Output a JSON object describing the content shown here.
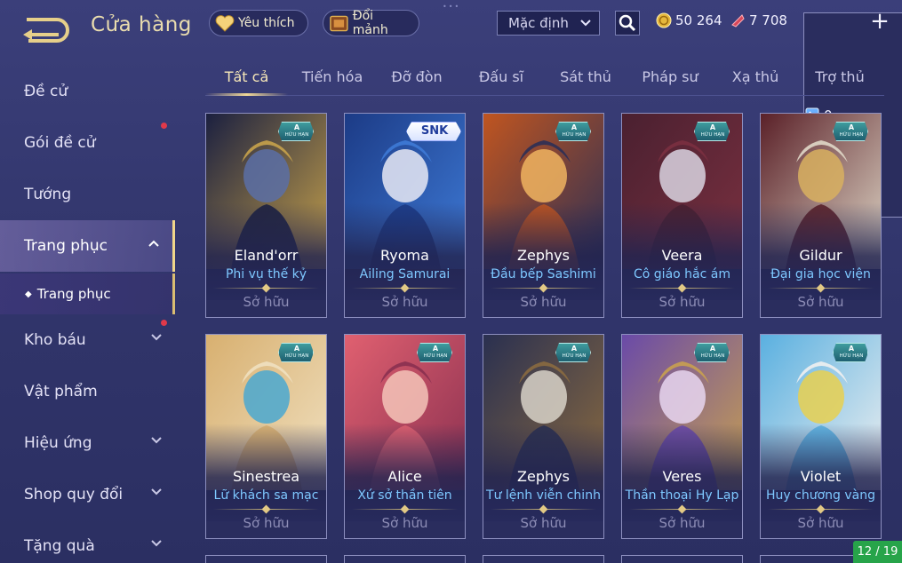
{
  "header": {
    "title": "Cửa hàng",
    "favorites_label": "Yêu thích",
    "exchange_label": "Đổi mảnh",
    "sort_value": "Mặc định",
    "currency_gold": "50 264",
    "currency_voucher": "7 708",
    "currency_card": "0",
    "add_symbol": "+",
    "drag_dots": "•••"
  },
  "sidebar": {
    "items": [
      {
        "label": "Đề cử"
      },
      {
        "label": "Gói đề cử"
      },
      {
        "label": "Tướng"
      },
      {
        "label": "Trang phục"
      },
      {
        "label": "Kho báu"
      },
      {
        "label": "Vật phẩm"
      },
      {
        "label": "Hiệu ứng"
      },
      {
        "label": "Shop quy đổi"
      },
      {
        "label": "Tặng quà"
      }
    ],
    "sub_item": "Trang phục"
  },
  "tabs": [
    "Tất cả",
    "Tiến hóa",
    "Đỡ đòn",
    "Đấu sĩ",
    "Sát thủ",
    "Pháp sư",
    "Xạ thủ",
    "Trợ thủ"
  ],
  "badge": {
    "grade": "A",
    "text": "HỮU HẠN",
    "snk": "SNK"
  },
  "cards": [
    {
      "hero": "Eland'orr",
      "skin": "Phi vụ thế kỷ",
      "status": "Sở hữu",
      "palette": [
        "#1b2040",
        "#5b6fa6",
        "#c7a24b"
      ]
    },
    {
      "hero": "Ryoma",
      "skin": "Ailing Samurai",
      "status": "Sở hữu",
      "palette": [
        "#1c3b86",
        "#e7e9f5",
        "#3e7ad6"
      ]
    },
    {
      "hero": "Zephys",
      "skin": "Đầu bếp Sashimi",
      "status": "Sở hữu",
      "palette": [
        "#c05520",
        "#f0b460",
        "#2c2f55"
      ]
    },
    {
      "hero": "Veera",
      "skin": "Cô giáo hắc ám",
      "status": "Sở hữu",
      "palette": [
        "#4a2030",
        "#d9d3e0",
        "#7a3040"
      ]
    },
    {
      "hero": "Gildur",
      "skin": "Đại gia học viện",
      "status": "Sở hữu",
      "palette": [
        "#5a2028",
        "#d8b060",
        "#e0d8c8"
      ]
    },
    {
      "hero": "Sinestrea",
      "skin": "Lữ khách sa mạc",
      "status": "Sở hữu",
      "palette": [
        "#d8b070",
        "#4aa8d0",
        "#f0e0c0"
      ]
    },
    {
      "hero": "Alice",
      "skin": "Xứ sở thần tiên",
      "status": "Sở hữu",
      "palette": [
        "#e06070",
        "#f4c4b8",
        "#8a3050"
      ]
    },
    {
      "hero": "Zephys",
      "skin": "Tư lệnh viễn chinh",
      "status": "Sở hữu",
      "palette": [
        "#2a3050",
        "#d8d2c8",
        "#8a6a40"
      ]
    },
    {
      "hero": "Veres",
      "skin": "Thần thoại Hy Lạp",
      "status": "Sở hữu",
      "palette": [
        "#6a4aa8",
        "#e8d6f0",
        "#c8a050"
      ]
    },
    {
      "hero": "Violet",
      "skin": "Huy chương vàng",
      "status": "Sở hữu",
      "palette": [
        "#5ab0e0",
        "#e8d050",
        "#f0f0f0"
      ]
    }
  ],
  "pager": "12 / 19",
  "colors": {
    "background": "#353a72",
    "accent_gold": "#f1d896",
    "skin_name": "#7ec8ff",
    "red_dot": "#e0394a",
    "pager_green": "#27a44a"
  }
}
